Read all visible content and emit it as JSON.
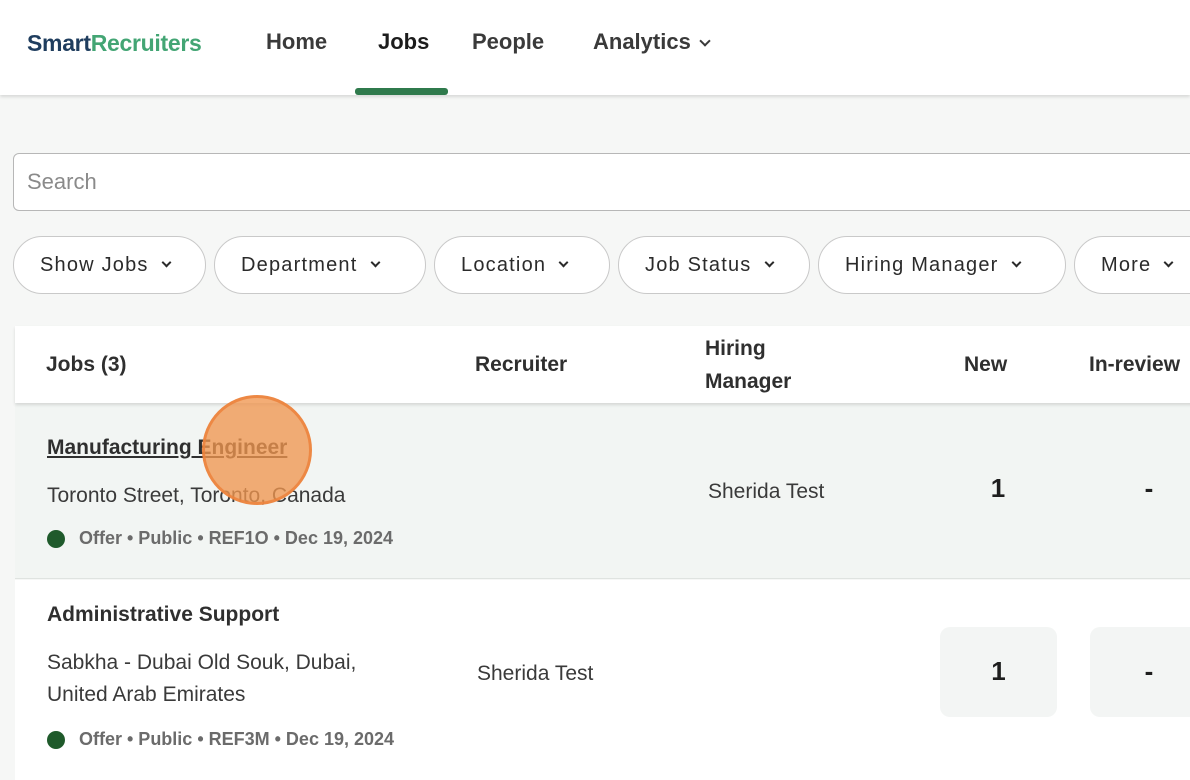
{
  "brand": {
    "part1": "Smart",
    "part2": "Recruiters"
  },
  "nav": {
    "home": "Home",
    "jobs": "Jobs",
    "people": "People",
    "analytics": "Analytics"
  },
  "search": {
    "placeholder": "Search"
  },
  "filters": {
    "show_jobs": "Show Jobs",
    "department": "Department",
    "location": "Location",
    "job_status": "Job Status",
    "hiring_manager": "Hiring Manager",
    "more": "More"
  },
  "table": {
    "headers": {
      "jobs": "Jobs (3)",
      "recruiter": "Recruiter",
      "hiring_manager_1": "Hiring",
      "hiring_manager_2": "Manager",
      "new": "New",
      "in_review": "In-review"
    },
    "rows": [
      {
        "title": "Manufacturing Engineer",
        "location": "Toronto Street, Toronto, Canada",
        "meta": "Offer • Public • REF1O • Dec 19, 2024",
        "recruiter": "",
        "hiring_manager": "Sherida Test",
        "new": "1",
        "in_review": "-"
      },
      {
        "title": "Administrative Support",
        "location_line1": "Sabkha - Dubai Old Souk, Dubai,",
        "location_line2": "United Arab Emirates",
        "meta": "Offer • Public • REF3M • Dec 19, 2024",
        "recruiter": "Sherida Test",
        "hiring_manager": "",
        "new": "1",
        "in_review": "-"
      }
    ]
  },
  "colors": {
    "brand_dark": "#1f3d5e",
    "brand_green": "#43a574",
    "active_underline": "#2f7a4c",
    "status_dot": "#1f5a2b",
    "click_marker": "#f0964f"
  }
}
